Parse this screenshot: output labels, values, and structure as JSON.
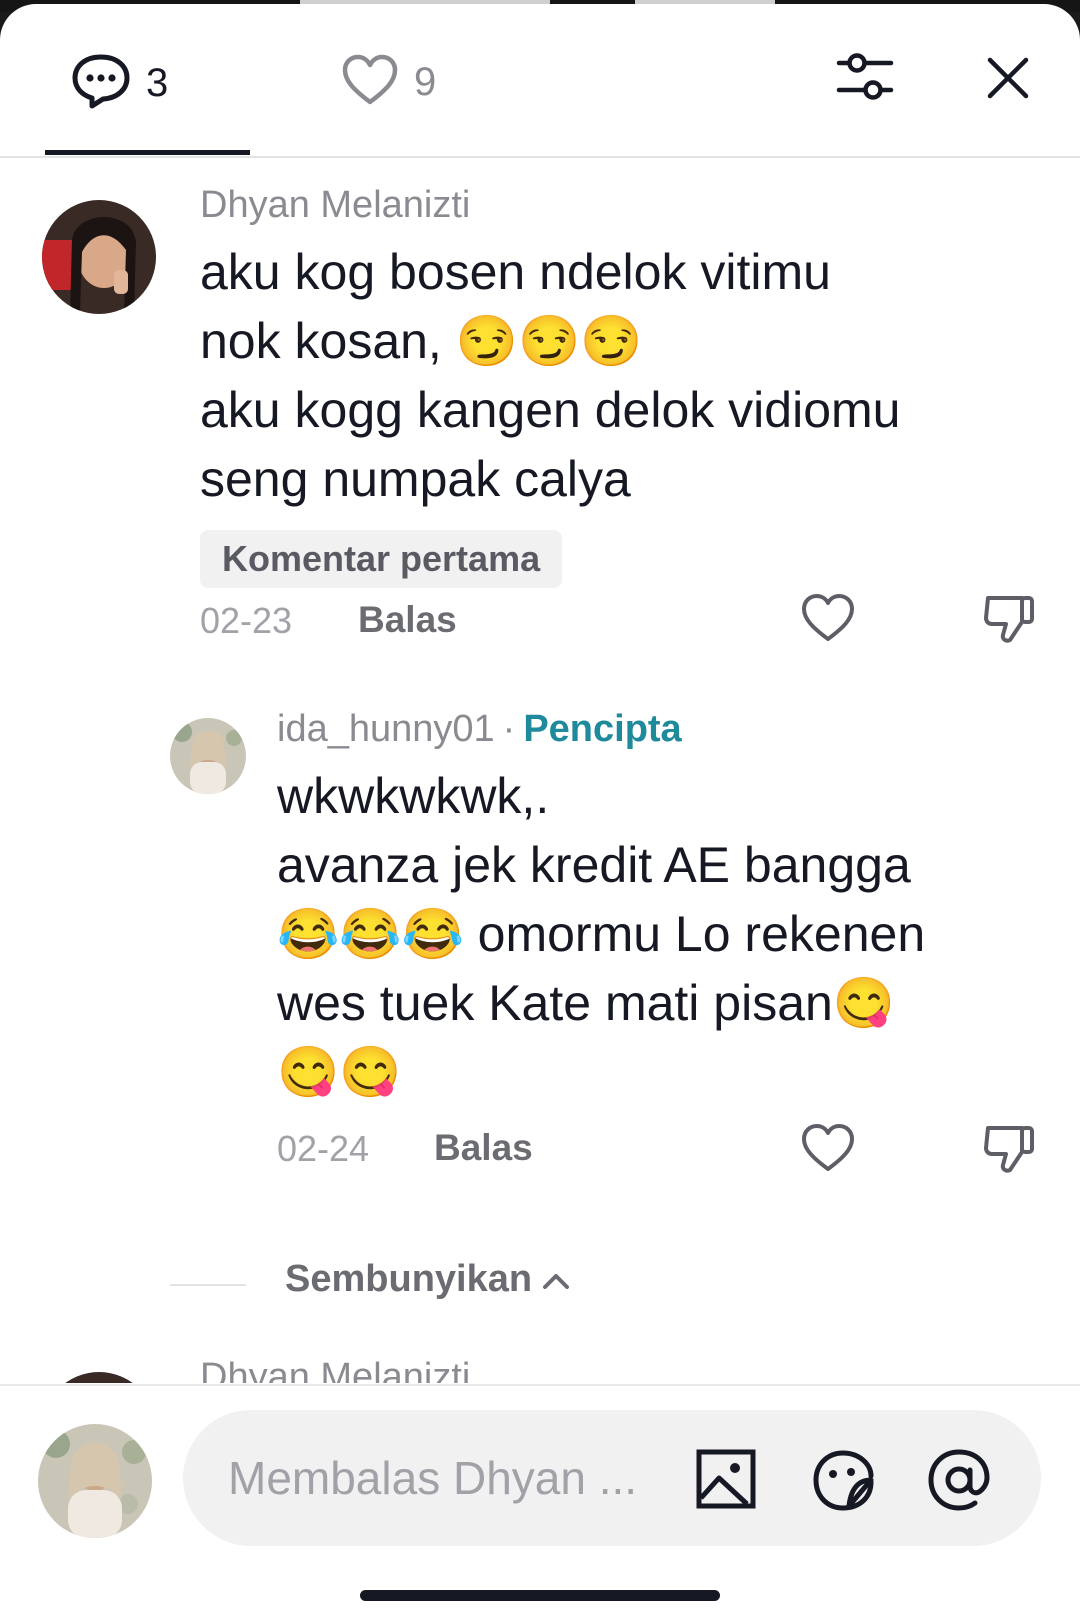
{
  "header": {
    "comments_count": "3",
    "likes_count": "9"
  },
  "comments": [
    {
      "username": "Dhyan Melanizti",
      "text": "aku kog bosen ndelok vitimu\nnok kosan, 😏😏😏\naku kogg kangen delok vidiomu\nseng numpak calya",
      "badge": "Komentar pertama",
      "date": "02-23",
      "reply_label": "Balas"
    },
    {
      "username": "ida_hunny01",
      "separator": "·",
      "creator_label": "Pencipta",
      "text": "wkwkwkwk,.\navanza jek kredit AE bangga\n😂😂😂 omormu Lo rekenen\nwes tuek Kate mati pisan😋\n😋😋",
      "date": "02-24",
      "reply_label": "Balas"
    }
  ],
  "hide_replies_label": "Sembunyikan",
  "next_comment_username": "Dhyan Melanizti",
  "composer": {
    "placeholder": "Membalas Dhyan ..."
  },
  "icons": [
    "comment-icon",
    "heart-icon",
    "filter-icon",
    "close-icon",
    "heart-outline-icon",
    "dislike-icon",
    "chevron-up-icon",
    "image-icon",
    "sticker-icon",
    "at-icon"
  ]
}
